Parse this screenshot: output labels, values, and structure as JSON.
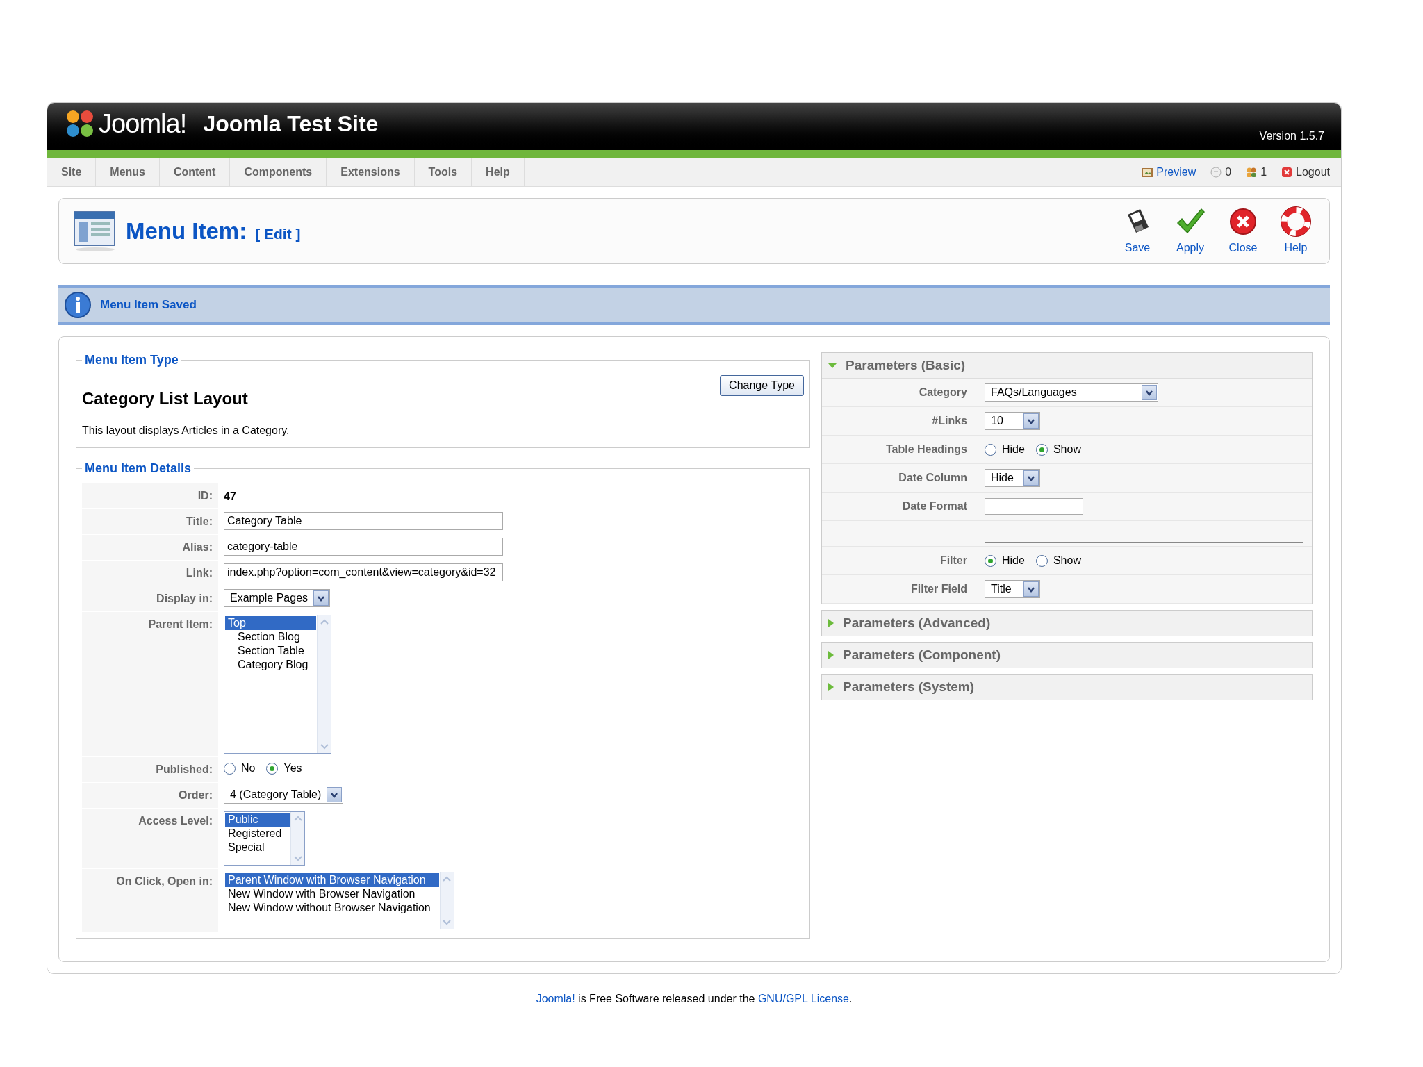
{
  "header": {
    "logo_text": "Joomla!",
    "site_title": "Joomla Test Site",
    "version": "Version 1.5.7"
  },
  "menu": [
    {
      "label": "Site"
    },
    {
      "label": "Menus"
    },
    {
      "label": "Content"
    },
    {
      "label": "Components"
    },
    {
      "label": "Extensions"
    },
    {
      "label": "Tools"
    },
    {
      "label": "Help"
    }
  ],
  "status_links": [
    {
      "kind": "preview",
      "label": "Preview"
    },
    {
      "kind": "messages",
      "label": "0"
    },
    {
      "kind": "users",
      "label": "1"
    },
    {
      "kind": "logout",
      "label": "Logout"
    }
  ],
  "toolbar": {
    "title": "Menu Item:",
    "subtitle": "[ Edit ]",
    "buttons": [
      {
        "kind": "save",
        "label": "Save"
      },
      {
        "kind": "apply",
        "label": "Apply"
      },
      {
        "kind": "close",
        "label": "Close"
      },
      {
        "kind": "help",
        "label": "Help"
      }
    ]
  },
  "message": "Menu Item Saved",
  "menu_item_type": {
    "legend": "Menu Item Type",
    "name": "Category List Layout",
    "description": "This layout displays Articles in a Category.",
    "button": "Change Type"
  },
  "details": {
    "legend": "Menu Item Details",
    "rows": [
      {
        "label": "ID:",
        "kind": "text",
        "value": "47"
      },
      {
        "label": "Title:",
        "kind": "input",
        "value": "Category Table"
      },
      {
        "label": "Alias:",
        "kind": "input",
        "value": "category-table"
      },
      {
        "label": "Link:",
        "kind": "input",
        "value": "index.php?option=com_content&view=category&id=32"
      },
      {
        "label": "Display in:",
        "kind": "select",
        "value": "Example Pages"
      },
      {
        "label": "Parent Item:",
        "kind": "list",
        "options": [
          {
            "label": "Top",
            "selected": true,
            "children": [
              {
                "label": "Section Blog",
                "selected": false
              },
              {
                "label": "Section Table",
                "selected": false
              },
              {
                "label": "Category Blog",
                "selected": false
              }
            ]
          }
        ]
      },
      {
        "label": "Published:",
        "kind": "radio",
        "options": [
          {
            "label": "No",
            "selected": false
          },
          {
            "label": "Yes",
            "selected": true
          }
        ]
      },
      {
        "label": "Order:",
        "kind": "select",
        "value": "4 (Category Table)"
      },
      {
        "label": "Access Level:",
        "kind": "list",
        "options": [
          {
            "label": "Public",
            "selected": true
          },
          {
            "label": "Registered",
            "selected": false
          },
          {
            "label": "Special",
            "selected": false
          }
        ]
      },
      {
        "label": "On Click, Open in:",
        "kind": "list",
        "options": [
          {
            "label": "Parent Window with Browser Navigation",
            "selected": true
          },
          {
            "label": "New Window with Browser Navigation",
            "selected": false
          },
          {
            "label": "New Window without Browser Navigation",
            "selected": false
          }
        ]
      }
    ]
  },
  "parameters": [
    {
      "title": "Parameters (Basic)",
      "expanded": true,
      "rows": [
        {
          "label": "Category",
          "kind": "select",
          "value": "FAQs/Languages"
        },
        {
          "label": "#Links",
          "kind": "select",
          "value": "10"
        },
        {
          "label": "Table Headings",
          "kind": "radio",
          "options": [
            {
              "label": "Hide",
              "selected": false
            },
            {
              "label": "Show",
              "selected": true
            }
          ]
        },
        {
          "label": "Date Column",
          "kind": "select",
          "value": "Hide"
        },
        {
          "label": "Date Format",
          "kind": "input"
        },
        {
          "kind": "separator"
        },
        {
          "label": "Filter",
          "kind": "radio",
          "options": [
            {
              "label": "Hide",
              "selected": true
            },
            {
              "label": "Show",
              "selected": false
            }
          ]
        },
        {
          "label": "Filter Field",
          "kind": "select",
          "value": "Title"
        }
      ]
    },
    {
      "title": "Parameters (Advanced)",
      "expanded": false
    },
    {
      "title": "Parameters (Component)",
      "expanded": false
    },
    {
      "title": "Parameters (System)",
      "expanded": false
    }
  ],
  "footer": [
    {
      "text": "Joomla!",
      "link": true
    },
    {
      "text": " is Free Software released under the ",
      "link": false
    },
    {
      "text": "GNU/GPL License",
      "link": true
    },
    {
      "text": ".",
      "link": false
    }
  ]
}
